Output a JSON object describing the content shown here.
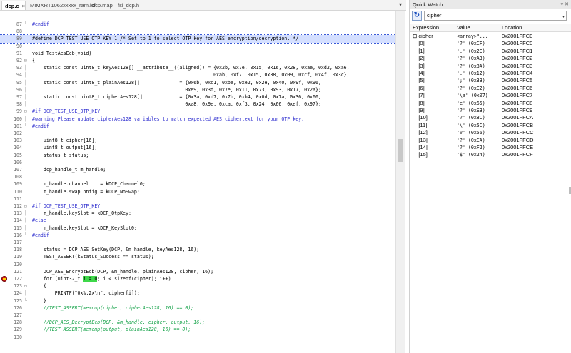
{
  "editor": {
    "tabs": [
      {
        "label": "dcp.c",
        "close": "×"
      },
      {
        "label": "MIMXRT1062xxxxx_ram.icf"
      },
      {
        "label": "dcp.map"
      },
      {
        "label": "fsl_dcp.h"
      }
    ],
    "tab_menu": "▾",
    "lines": [
      {
        "n": "87",
        "fold": "└",
        "text": "#endif",
        "kind": "pp"
      },
      {
        "n": "88",
        "fold": "",
        "text": "",
        "kind": ""
      },
      {
        "n": "89",
        "fold": "",
        "text": "#define DCP_TEST_USE_OTP_KEY 1 /* Set to 1 to select OTP key for AES encryption/decryption. */",
        "kind": "",
        "hl": "line"
      },
      {
        "n": "90",
        "fold": "",
        "text": "",
        "kind": ""
      },
      {
        "n": "91",
        "fold": "",
        "text": "void TestAesEcb(void)",
        "kind": ""
      },
      {
        "n": "92",
        "fold": "⊟",
        "text": "{",
        "kind": ""
      },
      {
        "n": "93",
        "fold": "│",
        "text": "    static const uint8_t keyAes128[] __attribute__((aligned)) = {0x2b, 0x7e, 0x15, 0x16, 0x28, 0xae, 0xd2, 0xa6,",
        "kind": ""
      },
      {
        "n": "94",
        "fold": "│",
        "text": "                                                                0xab, 0xf7, 0x15, 0x88, 0x09, 0xcf, 0x4f, 0x3c};",
        "kind": ""
      },
      {
        "n": "95",
        "fold": "│",
        "text": "    static const uint8_t plainAes128[]              = {0x6b, 0xc1, 0xbe, 0xe2, 0x2e, 0x40, 0x9f, 0x96,",
        "kind": ""
      },
      {
        "n": "96",
        "fold": "│",
        "text": "                                                      0xe9, 0x3d, 0x7e, 0x11, 0x73, 0x93, 0x17, 0x2a};",
        "kind": ""
      },
      {
        "n": "97",
        "fold": "│",
        "text": "    static const uint8_t cipherAes128[]             = {0x3a, 0xd7, 0x7b, 0xb4, 0x0d, 0x7a, 0x36, 0x60,",
        "kind": ""
      },
      {
        "n": "98",
        "fold": "│",
        "text": "                                                      0xa8, 0x9e, 0xca, 0xf3, 0x24, 0x66, 0xef, 0x97};",
        "kind": ""
      },
      {
        "n": "99",
        "fold": "⊟",
        "text": "#if DCP_TEST_USE_OTP_KEY",
        "kind": "pp"
      },
      {
        "n": "100",
        "fold": "│",
        "text": "#warning Please update cipherAes128 variables to match expected AES ciphertext for your OTP key.",
        "kind": "pp"
      },
      {
        "n": "101",
        "fold": "└",
        "text": "#endif",
        "kind": "pp"
      },
      {
        "n": "102",
        "fold": "",
        "text": "",
        "kind": ""
      },
      {
        "n": "103",
        "fold": "",
        "text": "    uint8_t cipher[16];",
        "kind": ""
      },
      {
        "n": "104",
        "fold": "",
        "text": "    uint8_t output[16];",
        "kind": ""
      },
      {
        "n": "105",
        "fold": "",
        "text": "    status_t status;",
        "kind": ""
      },
      {
        "n": "106",
        "fold": "",
        "text": "",
        "kind": ""
      },
      {
        "n": "107",
        "fold": "",
        "text": "    dcp_handle_t m_handle;",
        "kind": ""
      },
      {
        "n": "108",
        "fold": "",
        "text": "",
        "kind": ""
      },
      {
        "n": "109",
        "fold": "",
        "text": "    m_handle.channel    = kDCP_Channel0;",
        "kind": ""
      },
      {
        "n": "110",
        "fold": "",
        "text": "    m_handle.swapConfig = kDCP_NoSwap;",
        "kind": ""
      },
      {
        "n": "111",
        "fold": "",
        "text": "",
        "kind": ""
      },
      {
        "n": "112",
        "fold": "⊟",
        "text": "#if DCP_TEST_USE_OTP_KEY",
        "kind": "pp"
      },
      {
        "n": "113",
        "fold": "│",
        "text": "    m_handle.keySlot = kDCP_OtpKey;",
        "kind": ""
      },
      {
        "n": "114",
        "fold": "├",
        "text": "#else",
        "kind": "pp"
      },
      {
        "n": "115",
        "fold": "│",
        "text": "    m_handle.keySlot = kDCP_KeySlot0;",
        "kind": ""
      },
      {
        "n": "116",
        "fold": "└",
        "text": "#endif",
        "kind": "pp"
      },
      {
        "n": "117",
        "fold": "",
        "text": "",
        "kind": ""
      },
      {
        "n": "118",
        "fold": "",
        "text": "    status = DCP_AES_SetKey(DCP, &m_handle, keyAes128, 16);",
        "kind": ""
      },
      {
        "n": "119",
        "fold": "",
        "text": "    TEST_ASSERT(kStatus_Success == status);",
        "kind": ""
      },
      {
        "n": "120",
        "fold": "",
        "text": "",
        "kind": ""
      },
      {
        "n": "121",
        "fold": "",
        "text": "    DCP_AES_EncryptEcb(DCP, &m_handle, plainAes128, cipher, 16);",
        "kind": ""
      },
      {
        "n": "122",
        "fold": "",
        "text": "    for (uint32_t ",
        "kind": "",
        "sel": "i = 0",
        "after": "; i < sizeof(cipher); i++)",
        "bp": true
      },
      {
        "n": "123",
        "fold": "⊟",
        "text": "    {",
        "kind": ""
      },
      {
        "n": "124",
        "fold": "│",
        "text": "        PRINTF(\"0x%.2x\\n\", cipher[i]);",
        "kind": ""
      },
      {
        "n": "125",
        "fold": "└",
        "text": "    }",
        "kind": ""
      },
      {
        "n": "126",
        "fold": "",
        "text": "    //TEST_ASSERT(memcmp(cipher, cipherAes128, 16) == 0);",
        "kind": "cm"
      },
      {
        "n": "127",
        "fold": "",
        "text": "",
        "kind": ""
      },
      {
        "n": "128",
        "fold": "",
        "text": "    //DCP_AES_DecryptEcb(DCP, &m_handle, cipher, output, 16);",
        "kind": "cm"
      },
      {
        "n": "129",
        "fold": "",
        "text": "    //TEST_ASSERT(memcmp(output, plainAes128, 16) == 0);",
        "kind": "cm"
      },
      {
        "n": "130",
        "fold": "",
        "text": "",
        "kind": ""
      }
    ]
  },
  "quick_watch": {
    "title": "Quick Watch",
    "title_buttons": "▾ ✕",
    "refresh_icon": "↻",
    "expression": "cipher",
    "dropdown_icon": "▾",
    "columns": [
      "Expression",
      "Value",
      "Location"
    ],
    "rows": [
      {
        "expr": "⊟ cipher",
        "value": "<array>\"...",
        "loc": "0x2001FFC0"
      },
      {
        "expr": "    [0]",
        "value": "'?' (0xCF)",
        "loc": "0x2001FFC0"
      },
      {
        "expr": "    [1]",
        "value": "'.' (0x2E)",
        "loc": "0x2001FFC1"
      },
      {
        "expr": "    [2]",
        "value": "'?' (0xA3)",
        "loc": "0x2001FFC2"
      },
      {
        "expr": "    [3]",
        "value": "'?' (0x8A)",
        "loc": "0x2001FFC3"
      },
      {
        "expr": "    [4]",
        "value": "'.' (0x12)",
        "loc": "0x2001FFC4"
      },
      {
        "expr": "    [5]",
        "value": "';' (0x3B)",
        "loc": "0x2001FFC5"
      },
      {
        "expr": "    [6]",
        "value": "'?' (0xE2)",
        "loc": "0x2001FFC6"
      },
      {
        "expr": "    [7]",
        "value": "'\\a' (0x07)",
        "loc": "0x2001FFC7"
      },
      {
        "expr": "    [8]",
        "value": "'e' (0x65)",
        "loc": "0x2001FFC8"
      },
      {
        "expr": "    [9]",
        "value": "'?' (0xEB)",
        "loc": "0x2001FFC9"
      },
      {
        "expr": "    [10]",
        "value": "'?' (0x8C)",
        "loc": "0x2001FFCA"
      },
      {
        "expr": "    [11]",
        "value": "'\\' (0x5C)",
        "loc": "0x2001FFCB"
      },
      {
        "expr": "    [12]",
        "value": "'V' (0x56)",
        "loc": "0x2001FFCC"
      },
      {
        "expr": "    [13]",
        "value": "'?' (0xCA)",
        "loc": "0x2001FFCD"
      },
      {
        "expr": "    [14]",
        "value": "'?' (0xF2)",
        "loc": "0x2001FFCE"
      },
      {
        "expr": "    [15]",
        "value": "'$' (0x24)",
        "loc": "0x2001FFCF"
      }
    ]
  },
  "colors": {
    "preprocessor": "#2f2fcf",
    "comment": "#16a34a",
    "selection": "#3fd84a",
    "line_highlight": "#d4dfff",
    "breakpoint": "#d11b1b"
  }
}
